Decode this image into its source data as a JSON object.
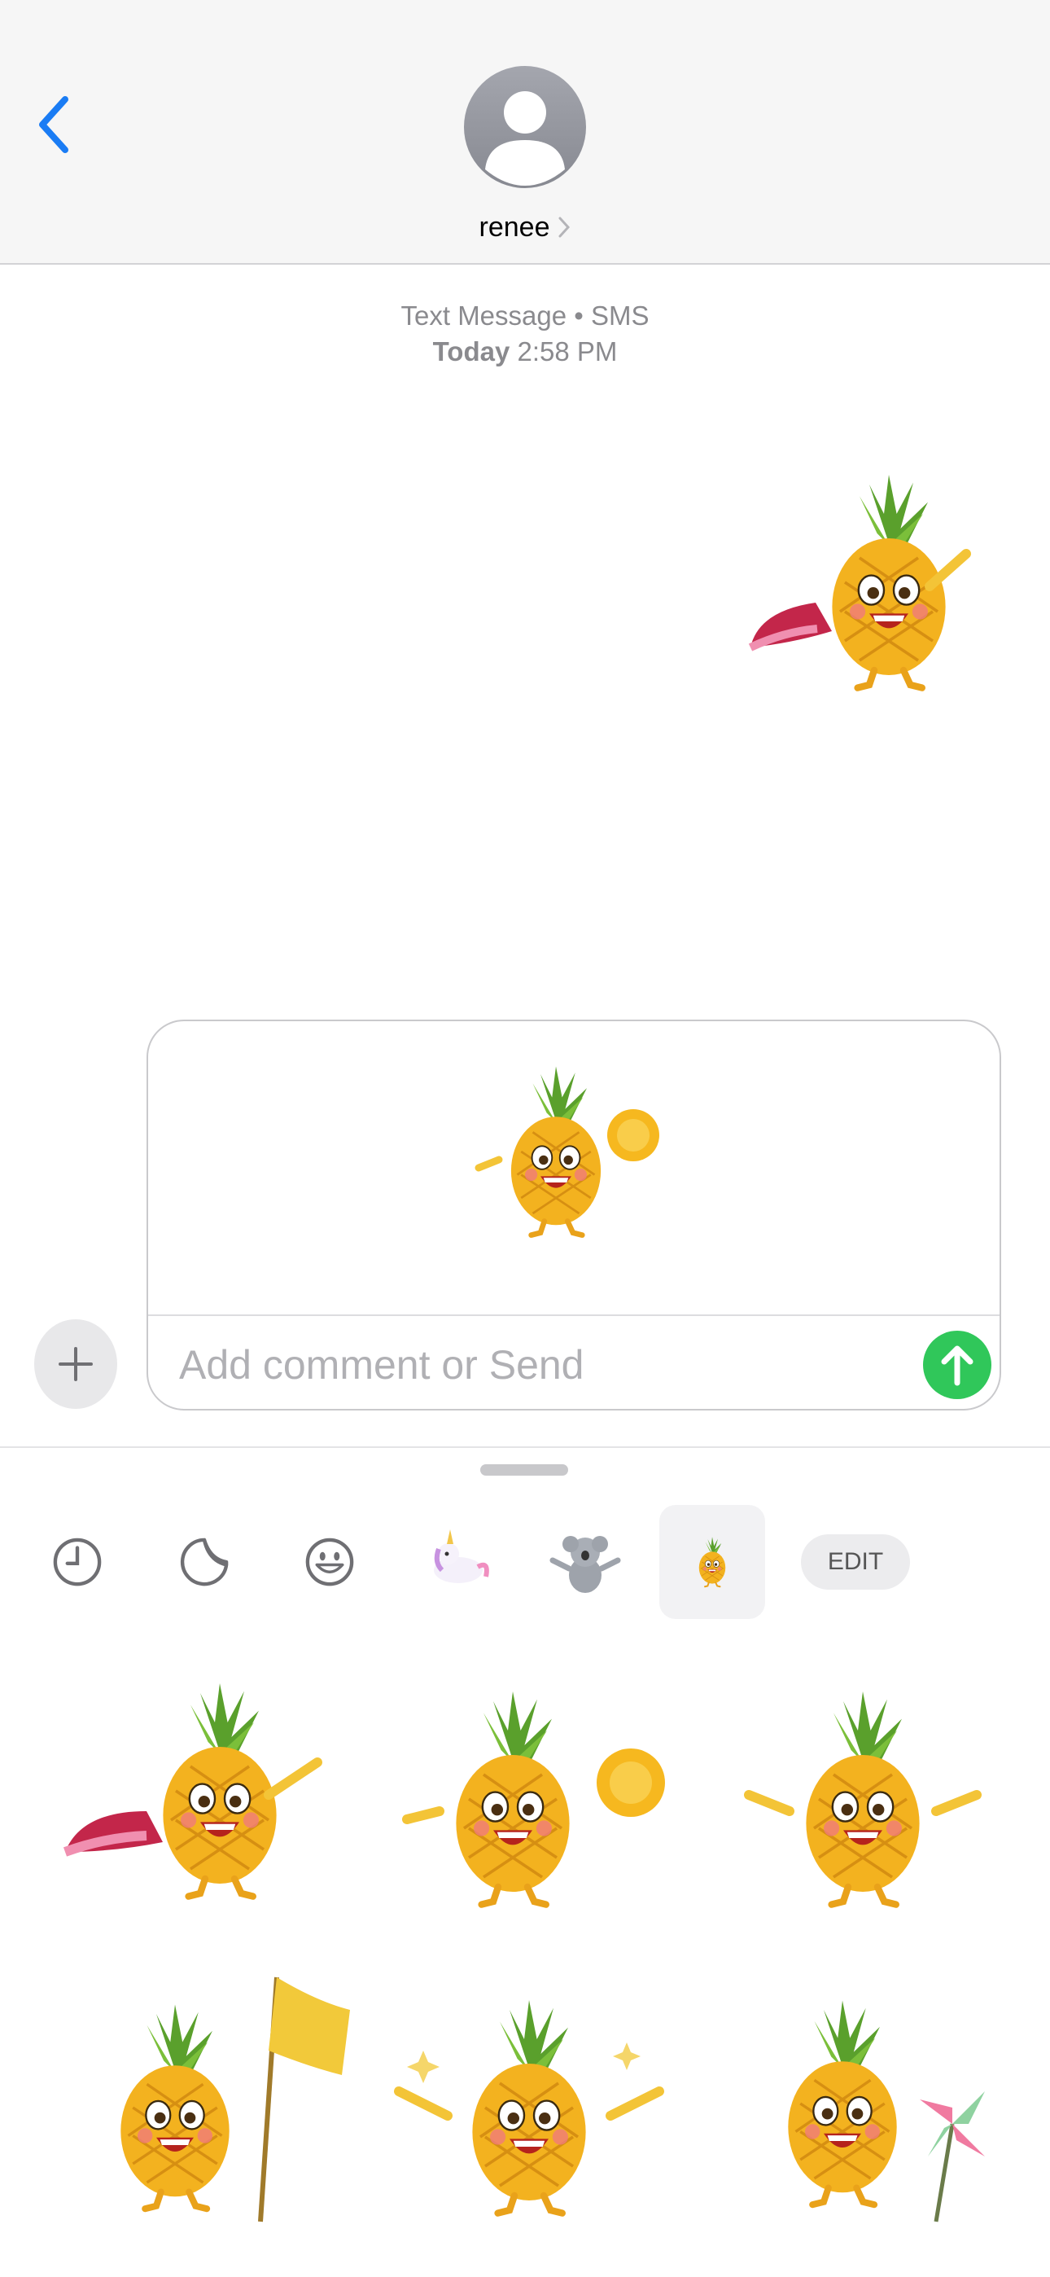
{
  "header": {
    "contact_name": "renee",
    "back_icon": "chevron-left-icon",
    "avatar_icon": "person-silhouette-icon"
  },
  "conversation": {
    "service": "Text Message • SMS",
    "date_day": "Today",
    "date_time": "2:58 PM",
    "sent_sticker": "pineapple-superhero-sticker"
  },
  "compose": {
    "attached_sticker": "pineapple-cheerleader-sticker",
    "placeholder": "Add comment or Send",
    "value": "",
    "plus_icon": "plus-icon",
    "send_icon": "arrow-up-icon"
  },
  "drawer": {
    "tabs": [
      {
        "name": "recent",
        "icon": "clock-icon"
      },
      {
        "name": "stickers",
        "icon": "sticker-peel-icon"
      },
      {
        "name": "emoji",
        "icon": "smiley-icon"
      },
      {
        "name": "unicorn-pack",
        "icon": "unicorn-sticker-icon"
      },
      {
        "name": "koala-pack",
        "icon": "koala-sticker-icon"
      },
      {
        "name": "pineapple-pack",
        "icon": "pineapple-sticker-icon",
        "selected": true
      }
    ],
    "edit_label": "EDIT",
    "stickers": [
      "pineapple-superhero-sticker",
      "pineapple-cheerleader-sticker",
      "pineapple-happy-sticker",
      "pineapple-flag-sticker",
      "pineapple-sparkle-sticker",
      "pineapple-pinwheel-sticker"
    ]
  },
  "colors": {
    "accent_blue": "#1a7cf4",
    "send_green": "#30c75a",
    "pineapple_body": "#f3b21f",
    "pineapple_leaves": "#5aa02c"
  }
}
